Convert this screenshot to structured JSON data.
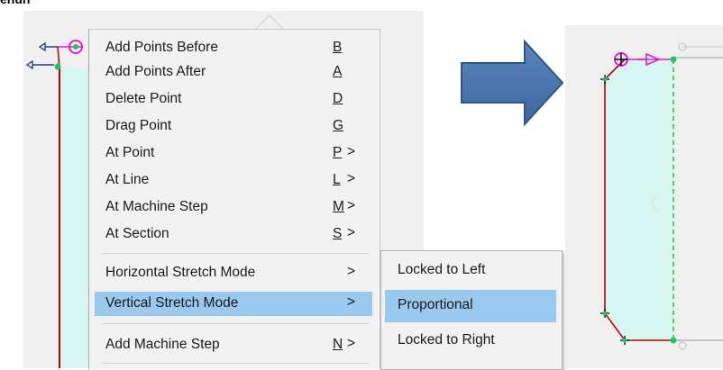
{
  "header": {
    "text": "ehun"
  },
  "menu": {
    "items": [
      {
        "label": "Add Points Before",
        "key": "B",
        "arrow": ""
      },
      {
        "label": "Add Points After",
        "key": "A",
        "arrow": ""
      },
      {
        "label": "Delete Point",
        "key": "D",
        "arrow": ""
      },
      {
        "label": "Drag Point",
        "key": "G",
        "arrow": ""
      },
      {
        "label": "At Point",
        "key": "P",
        "arrow": ">"
      },
      {
        "label": "At Line",
        "key": "L",
        "arrow": ">"
      },
      {
        "label": "At Machine Step",
        "key": "M",
        "arrow": ">"
      },
      {
        "label": "At Section",
        "key": "S",
        "arrow": ">"
      },
      {
        "label": "Horizontal Stretch Mode",
        "key": "",
        "arrow": ">"
      },
      {
        "label": "Vertical Stretch Mode",
        "key": "",
        "arrow": ">"
      },
      {
        "label": "Add Machine Step",
        "key": "N",
        "arrow": ">"
      }
    ],
    "highlighted": "Vertical Stretch Mode"
  },
  "submenu": {
    "items": [
      {
        "label": "Locked to Left"
      },
      {
        "label": "Proportional"
      },
      {
        "label": "Locked to Right"
      }
    ],
    "highlighted": "Proportional"
  },
  "colors": {
    "highlight": "#99c9ef",
    "shape_fill": "#d9f7f2",
    "edge_red": "#c00000",
    "node_green": "#22c55e",
    "magenta": "#e01ad0",
    "arrow_blue": "#3f6fa8"
  },
  "icons": [
    "left-arrow-icon",
    "big-right-arrow-icon",
    "node-marker-icon",
    "right-pointer-icon"
  ]
}
